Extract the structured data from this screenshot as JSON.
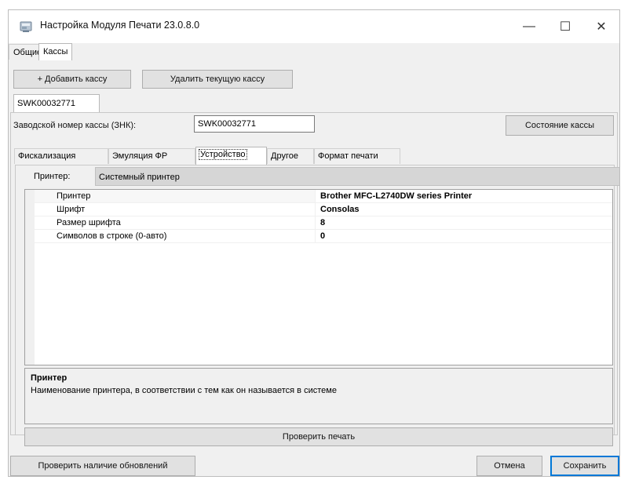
{
  "window": {
    "title": "Настройка Модуля Печати 23.0.8.0",
    "controls": {
      "minimize": "—",
      "maximize": "☐",
      "close": "✕"
    }
  },
  "top_tabs": [
    {
      "label": "Общие",
      "active": false
    },
    {
      "label": "Кассы",
      "active": true
    }
  ],
  "toolbar": {
    "add_label": "+ Добавить кассу",
    "delete_label": "Удалить текущую кассу"
  },
  "kassa_tab": "SWK00032771",
  "serial": {
    "label": "Заводской номер кассы (ЗНК):",
    "value": "SWK00032771"
  },
  "status_button": "Состояние кассы",
  "inner_tabs": [
    {
      "label": "Фискализация",
      "active": false
    },
    {
      "label": "Эмуляция ФР",
      "active": false
    },
    {
      "label": "Устройство",
      "active": true
    },
    {
      "label": "Другое",
      "active": false
    },
    {
      "label": "Формат печати",
      "active": false
    }
  ],
  "printer_type": {
    "label": "Принтер:",
    "value": "Системный принтер"
  },
  "properties": [
    {
      "name": "Принтер",
      "value": "Brother MFC-L2740DW series Printer"
    },
    {
      "name": "Шрифт",
      "value": "Consolas"
    },
    {
      "name": "Размер шрифта",
      "value": "8"
    },
    {
      "name": "Символов в строке (0-авто)",
      "value": "0"
    }
  ],
  "description": {
    "title": "Принтер",
    "text": "Наименование принтера, в соответствии с тем как он называется в системе"
  },
  "test_print_button": "Проверить печать",
  "footer": {
    "check_updates": "Проверить наличие обновлений",
    "cancel": "Отмена",
    "save": "Сохранить"
  },
  "colors": {
    "accent": "#0078d7",
    "window_bg": "#f0f0f0"
  },
  "icons": {
    "app": "printer-module-icon"
  }
}
